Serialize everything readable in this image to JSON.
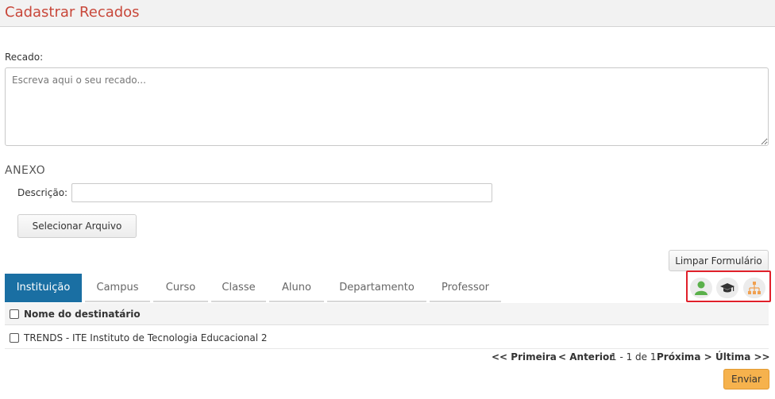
{
  "page": {
    "title": "Cadastrar Recados"
  },
  "form": {
    "recado_label": "Recado:",
    "recado_placeholder": "Escreva aqui o seu recado...",
    "anexo_title": "ANEXO",
    "descricao_label": "Descrição:",
    "descricao_value": "",
    "select_file_label": "Selecionar Arquivo",
    "clear_label": "Limpar Formulário"
  },
  "tabs": [
    {
      "label": "Instituição",
      "active": true
    },
    {
      "label": "Campus"
    },
    {
      "label": "Curso"
    },
    {
      "label": "Classe"
    },
    {
      "label": "Aluno"
    },
    {
      "label": "Departamento"
    },
    {
      "label": "Professor"
    }
  ],
  "icons": [
    "person-icon",
    "graduation-cap-icon",
    "org-chart-icon"
  ],
  "colors": {
    "accent": "#1a6fa3",
    "title": "#c8473a",
    "send": "#f6b24d",
    "highlight": "#e0202a",
    "person": "#5ab04a",
    "org": "#f0a050"
  },
  "table": {
    "header": "Nome do destinatário",
    "rows": [
      {
        "name": "TRENDS - ITE Instituto de Tecnologia Educacional 2"
      }
    ]
  },
  "pagination": {
    "first": "<< Primeira",
    "prev": "< Anterior",
    "info": "1 - 1 de 1",
    "next": "Próxima >",
    "last": "Última >>"
  },
  "send_label": "Enviar"
}
